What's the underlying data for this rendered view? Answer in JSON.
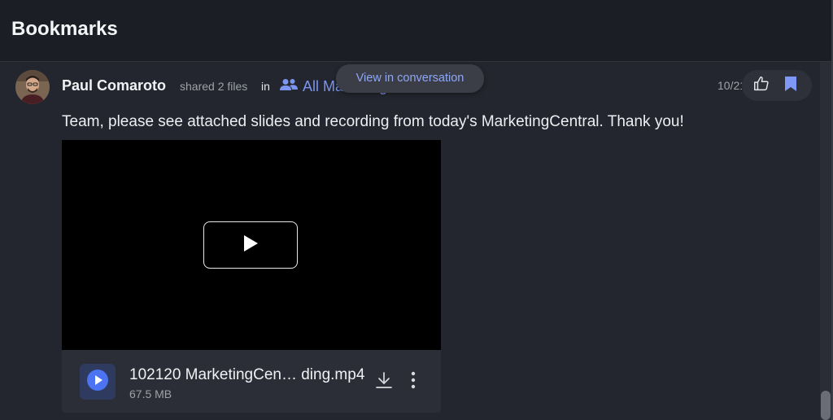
{
  "header": {
    "title": "Bookmarks"
  },
  "post": {
    "author": "Paul Comaroto",
    "action": "shared 2 files",
    "in_word": "in",
    "channel": "All Marketing",
    "timestamp": "10/21",
    "message": "Team, please see attached slides and recording from today's MarketingCentral. Thank you!"
  },
  "tooltip": {
    "text": "View in conversation"
  },
  "attachment": {
    "file_name": "102120 MarketingCen… ding.mp4",
    "file_size": "67.5 MB"
  },
  "colors": {
    "accent": "#7b95f0",
    "play_blue": "#4b73f2",
    "bookmark": "#7f97f6",
    "background": "#23262e"
  },
  "icons": {
    "channel": "group-icon",
    "like": "thumbs-up-icon",
    "bookmark": "bookmark-icon",
    "play": "play-icon",
    "download": "download-icon",
    "more": "more-vertical-icon"
  }
}
